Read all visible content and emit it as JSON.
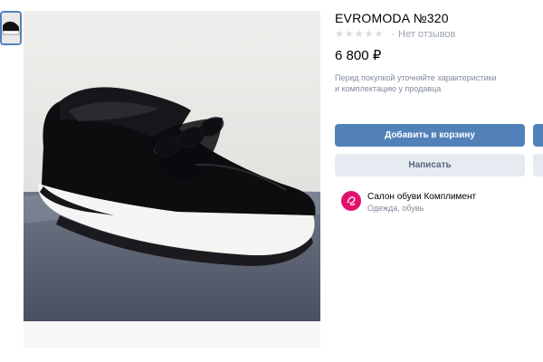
{
  "product": {
    "title": "EVROMODA №320",
    "reviews_text": "Нет отзывов",
    "rating_stars": 0,
    "price": "6 800 ₽",
    "note_line1": "Перед покупкой уточняйте характеристики",
    "note_line2": "и комплектацию у продавца",
    "image_subject": "black suede loafer sneaker with white platform sole"
  },
  "actions": {
    "add_to_cart": "Добавить в корзину",
    "write": "Написать"
  },
  "seller": {
    "name": "Салон обуви Комплимент",
    "category": "Одежда, обувь"
  },
  "colors": {
    "accent": "#5181b8",
    "secondary_button": "#e5ebf1",
    "avatar": "#e2116e"
  },
  "icons": [
    "star-icon",
    "seller-logo-icon"
  ]
}
